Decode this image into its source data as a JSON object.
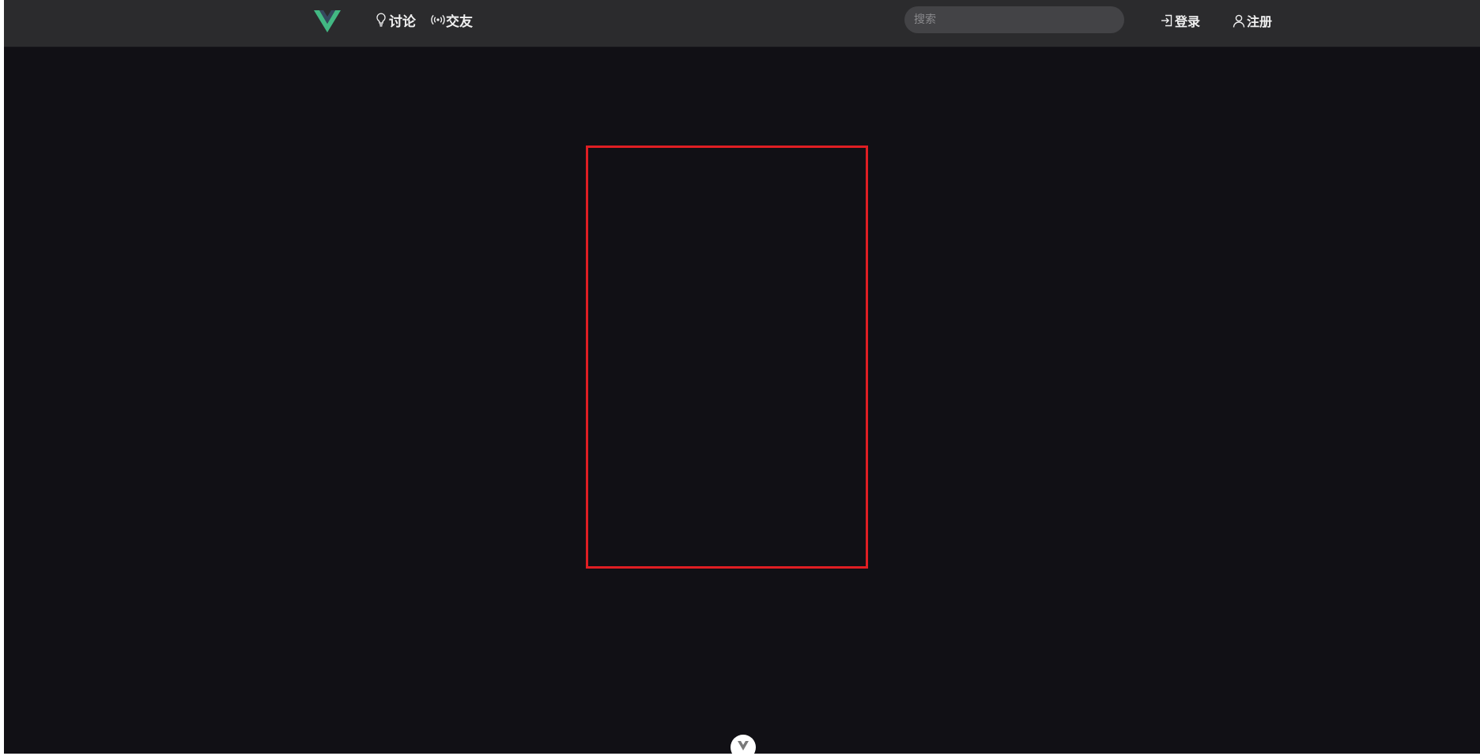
{
  "header": {
    "logo_icon": "vue-logo-icon",
    "nav": [
      {
        "label": "讨论",
        "icon": "lightbulb-icon"
      },
      {
        "label": "交友",
        "icon": "broadcast-icon"
      }
    ],
    "search": {
      "placeholder": "搜索",
      "value": ""
    },
    "auth": {
      "login_label": "登录",
      "login_icon": "sign-in-icon",
      "register_label": "注册",
      "register_icon": "user-icon"
    }
  },
  "colors": {
    "background": "#111015",
    "header": "#2b2b2d",
    "accent_green": "#42b883",
    "accent_dark": "#35495e",
    "highlight_border": "#e01e23"
  },
  "footer": {
    "scroll_icon": "chevron-down-icon"
  }
}
